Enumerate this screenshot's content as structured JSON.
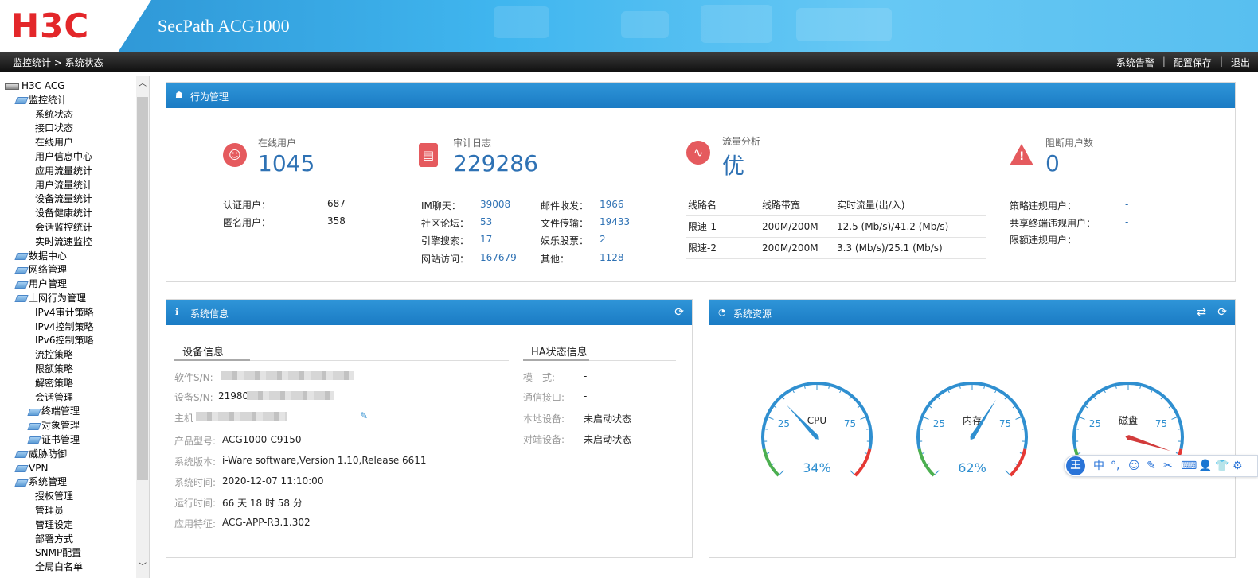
{
  "header": {
    "logo": "H3C",
    "product": "SecPath ACG1000"
  },
  "topbar": {
    "breadcrumb": "监控统计 > 系统状态",
    "links": [
      "系统告警",
      "配置保存",
      "退出"
    ]
  },
  "sidebar": {
    "root": "H3C ACG",
    "items": [
      {
        "label": "监控统计",
        "level": 1
      },
      {
        "label": "系统状态",
        "level": 2
      },
      {
        "label": "接口状态",
        "level": 2
      },
      {
        "label": "在线用户",
        "level": 2
      },
      {
        "label": "用户信息中心",
        "level": 2
      },
      {
        "label": "应用流量统计",
        "level": 2
      },
      {
        "label": "用户流量统计",
        "level": 2
      },
      {
        "label": "设备流量统计",
        "level": 2
      },
      {
        "label": "设备健康统计",
        "level": 2
      },
      {
        "label": "会话监控统计",
        "level": 2
      },
      {
        "label": "实时流速监控",
        "level": 2
      },
      {
        "label": "数据中心",
        "level": 1
      },
      {
        "label": "网络管理",
        "level": 1
      },
      {
        "label": "用户管理",
        "level": 1
      },
      {
        "label": "上网行为管理",
        "level": 1
      },
      {
        "label": "IPv4审计策略",
        "level": 2
      },
      {
        "label": "IPv4控制策略",
        "level": 2
      },
      {
        "label": "IPv6控制策略",
        "level": 2
      },
      {
        "label": "流控策略",
        "level": 2
      },
      {
        "label": "限额策略",
        "level": 2
      },
      {
        "label": "解密策略",
        "level": 2
      },
      {
        "label": "会话管理",
        "level": 2
      },
      {
        "label": "终端管理",
        "level": 3
      },
      {
        "label": "对象管理",
        "level": 3
      },
      {
        "label": "证书管理",
        "level": 3
      },
      {
        "label": "威胁防御",
        "level": 1
      },
      {
        "label": "VPN",
        "level": 1
      },
      {
        "label": "系统管理",
        "level": 1
      },
      {
        "label": "授权管理",
        "level": 2
      },
      {
        "label": "管理员",
        "level": 2
      },
      {
        "label": "管理设定",
        "level": 2
      },
      {
        "label": "部署方式",
        "level": 2
      },
      {
        "label": "SNMP配置",
        "level": 2
      },
      {
        "label": "全局白名单",
        "level": 2
      }
    ]
  },
  "behavior": {
    "title": "行为管理",
    "online_users": {
      "label": "在线用户",
      "value": "1045",
      "rows": [
        {
          "k": "认证用户：",
          "v": "687"
        },
        {
          "k": "匿名用户：",
          "v": "358"
        }
      ]
    },
    "audit_log": {
      "label": "审计日志",
      "value": "229286",
      "rows": [
        {
          "k": "IM聊天：",
          "v": "39008",
          "k2": "邮件收发：",
          "v2": "1966"
        },
        {
          "k": "社区论坛：",
          "v": "53",
          "k2": "文件传输：",
          "v2": "19433"
        },
        {
          "k": "引擎搜索：",
          "v": "17",
          "k2": "娱乐股票：",
          "v2": "2"
        },
        {
          "k": "网站访问：",
          "v": "167679",
          "k2": "其他：",
          "v2": "1128"
        }
      ]
    },
    "traffic": {
      "label": "流量分析",
      "value": "优",
      "columns": [
        "线路名",
        "线路带宽",
        "实时流量(出/入)"
      ],
      "rows": [
        [
          "限速-1",
          "200M/200M",
          "12.5 (Mb/s)/41.2 (Mb/s)"
        ],
        [
          "限速-2",
          "200M/200M",
          "3.3 (Mb/s)/25.1 (Mb/s)"
        ]
      ]
    },
    "blocked": {
      "label": "阻断用户数",
      "value": "0",
      "rows": [
        {
          "k": "策略违规用户：",
          "v": "-"
        },
        {
          "k": "共享终端违规用户：",
          "v": "-"
        },
        {
          "k": "限额违规用户：",
          "v": "-"
        }
      ]
    }
  },
  "sysinfo": {
    "title": "系统信息",
    "tab_device": "设备信息",
    "tab_ha": "HA状态信息",
    "fields": [
      {
        "k": "软件S/N:",
        "v": ""
      },
      {
        "k": "设备S/N:",
        "v": "21980"
      },
      {
        "k": "主机",
        "v": ""
      },
      {
        "k": "产品型号:",
        "v": "ACG1000-C9150"
      },
      {
        "k": "系统版本:",
        "v": "i-Ware software,Version 1.10,Release 6611"
      },
      {
        "k": "系统时间:",
        "v": "2020-12-07 11:10:00"
      },
      {
        "k": "运行时间:",
        "v": "66 天 18 时 58 分"
      },
      {
        "k": "应用特征:",
        "v": "ACG-APP-R3.1.302"
      }
    ],
    "ha_fields": [
      {
        "k": "模　式:",
        "v": "-"
      },
      {
        "k": "通信接口:",
        "v": "-"
      },
      {
        "k": "本地设备:",
        "v": "未启动状态"
      },
      {
        "k": "对端设备:",
        "v": "未启动状态"
      }
    ]
  },
  "resources": {
    "title": "系统资源",
    "gauges": [
      {
        "label": "CPU",
        "percent": 34,
        "value_text": "34%",
        "tick_low": "25",
        "tick_high": "75"
      },
      {
        "label": "内存",
        "percent": 62,
        "value_text": "62%",
        "tick_low": "25",
        "tick_high": "75"
      },
      {
        "label": "磁盘",
        "percent": 90,
        "value_text": "",
        "tick_low": "25",
        "tick_high": "75"
      }
    ]
  },
  "ime": {
    "logo": "王",
    "buttons": [
      "中",
      "°,",
      "☺",
      "✎",
      "✂",
      "⌨",
      "👤",
      "👕",
      "⚙"
    ]
  },
  "colors": {
    "header_blue": "#2a8fd0",
    "panel_blue": "#1a7bc4",
    "accent_red": "#e55a5e",
    "value_blue": "#2f72b4"
  }
}
